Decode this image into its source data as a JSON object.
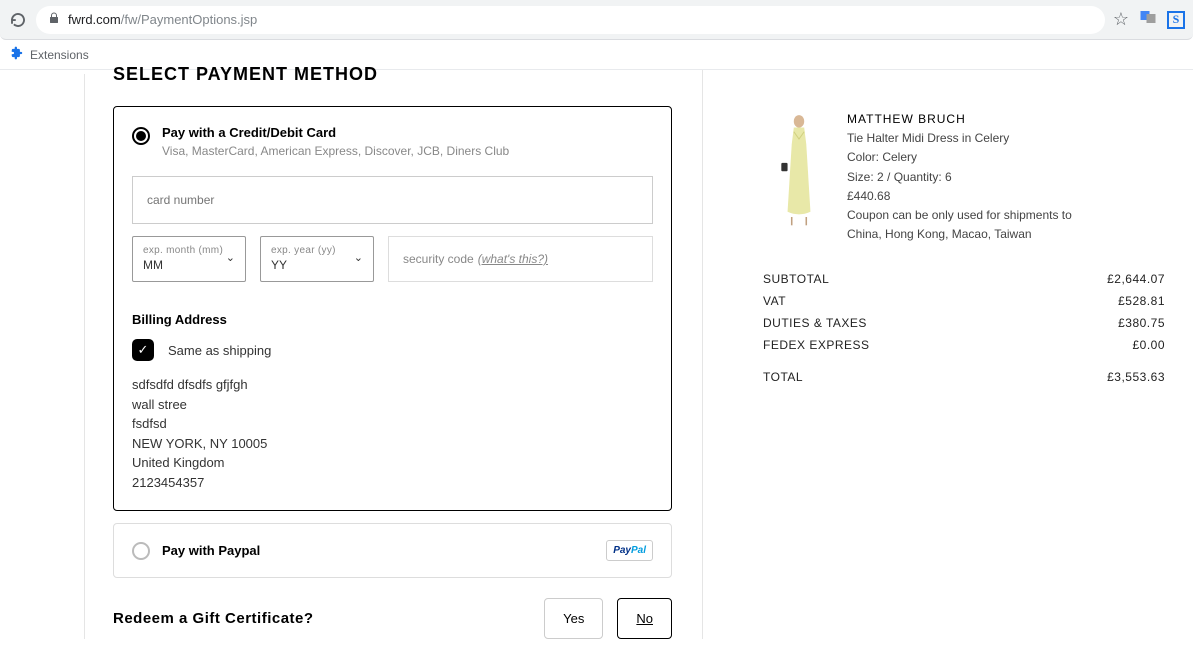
{
  "browser": {
    "url_domain": "fwrd.com",
    "url_path": "/fw/PaymentOptions.jsp",
    "extensions_label": "Extensions"
  },
  "page": {
    "section_title": "SELECT PAYMENT METHOD",
    "credit_card": {
      "title": "Pay with a Credit/Debit Card",
      "subtitle": "Visa, MasterCard, American Express, Discover, JCB, Diners Club",
      "card_number_placeholder": "card number",
      "exp_month_label": "exp. month (mm)",
      "exp_month_value": "MM",
      "exp_year_label": "exp. year (yy)",
      "exp_year_value": "YY",
      "security_label": "security code",
      "whats_this": "(what's this?)"
    },
    "billing": {
      "title": "Billing Address",
      "same_as_shipping": "Same as shipping",
      "line1": "sdfsdfd dfsdfs gfjfgh",
      "line2": "wall stree",
      "line3": "fsdfsd",
      "line4": "NEW YORK, NY 10005",
      "line5": "United Kingdom",
      "line6": "2123454357"
    },
    "paypal": {
      "title": "Pay with Paypal"
    },
    "gift": {
      "title": "Redeem a Gift Certificate?",
      "yes": "Yes",
      "no": "No"
    }
  },
  "order": {
    "product": {
      "brand": "MATTHEW BRUCH",
      "name": "Tie Halter Midi Dress in Celery",
      "color": "Color: Celery",
      "size_qty": "Size: 2 / Quantity: 6",
      "price": "£440.68",
      "coupon_note": "Coupon can be only used for shipments to China, Hong Kong, Macao, Taiwan"
    },
    "summary": {
      "subtotal_label": "SUBTOTAL",
      "subtotal_value": "£2,644.07",
      "vat_label": "VAT",
      "vat_value": "£528.81",
      "duties_label": "DUTIES & TAXES",
      "duties_value": "£380.75",
      "shipping_label": "FEDEX EXPRESS",
      "shipping_value": "£0.00",
      "total_label": "TOTAL",
      "total_value": "£3,553.63"
    }
  }
}
